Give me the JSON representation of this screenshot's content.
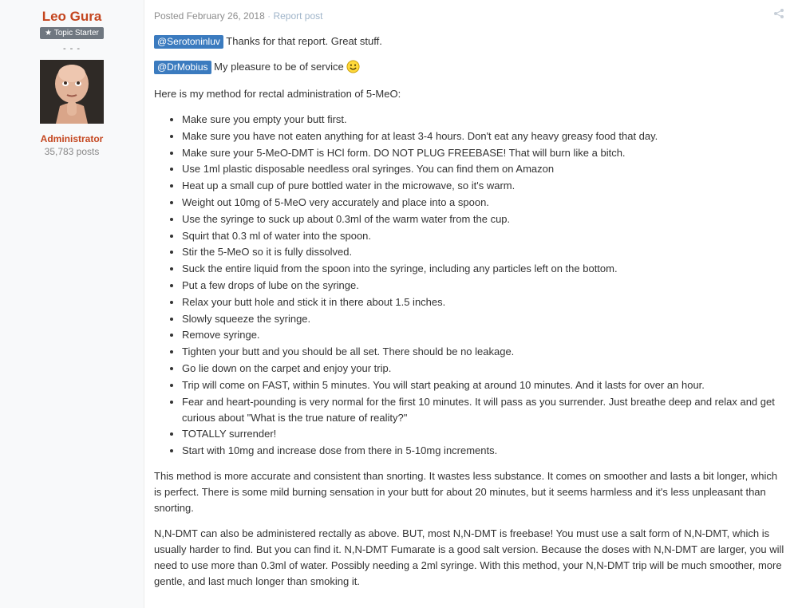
{
  "author": {
    "name": "Leo Gura",
    "badge": "Topic Starter",
    "dashes": "- - -",
    "role": "Administrator",
    "post_count": "35,783 posts"
  },
  "post": {
    "posted_label": "Posted February 26, 2018",
    "separator": "·",
    "report_label": "Report post",
    "mention1": "@Serotoninluv",
    "reply1": "Thanks for that report. Great stuff.",
    "mention2": "@DrMobius",
    "reply2": "My pleasure to be of service",
    "intro": "Here is my method for rectal administration of 5-MeO:",
    "steps": [
      "Make sure you empty your butt first.",
      "Make sure you have not eaten anything for at least 3-4 hours. Don't eat any heavy greasy food that day.",
      "Make sure your 5-MeO-DMT is HCl form. DO NOT PLUG FREEBASE! That will burn like a bitch.",
      "Use 1ml plastic disposable needless oral syringes. You can find them on Amazon",
      "Heat up a small cup of pure bottled water in the microwave, so it's warm.",
      "Weight out 10mg of 5-MeO very accurately and place into a spoon.",
      "Use the syringe to suck up about 0.3ml of the warm water from the cup.",
      "Squirt that 0.3 ml of water into the spoon.",
      "Stir the 5-MeO so it is fully dissolved.",
      "Suck the entire liquid from the spoon into the syringe, including any particles left on the bottom.",
      "Put a few drops of lube on the syringe.",
      "Relax your butt hole and stick it in there about 1.5 inches.",
      "Slowly squeeze the syringe.",
      "Remove syringe.",
      "Tighten your butt and you should be all set. There should be no leakage.",
      "Go lie down on the carpet and enjoy your trip.",
      "Trip will come on FAST, within 5 minutes. You will start peaking at around 10 minutes. And it lasts for over an hour.",
      "Fear and heart-pounding is very normal for the first 10 minutes. It will pass as you surrender. Just breathe deep and relax and get curious about \"What is the true nature of reality?\"",
      "TOTALLY surrender!",
      "Start with 10mg and increase dose from there in 5-10mg increments."
    ],
    "para1": "This method is more accurate and consistent than snorting. It wastes less substance. It comes on smoother and lasts a bit longer, which is perfect. There is some mild burning sensation in your butt for about 20 minutes, but it seems harmless and it's less unpleasant than snorting.",
    "para2": "N,N-DMT can also be administered rectally as above. BUT, most N,N-DMT is freebase! You must use a salt form of N,N-DMT, which is usually harder to find. But you can find it. N,N-DMT Fumarate is a good salt version. Because the doses with N,N-DMT are larger, you will need to use more than 0.3ml of water. Possibly needing a 2ml syringe. With this method, your N,N-DMT trip will be much smoother, more gentle, and last much longer than smoking it."
  },
  "icons": [
    "star-icon",
    "share-icon",
    "smiley-icon"
  ],
  "colors": {
    "author": "#c4461f",
    "mention_bg": "#3b7bbf",
    "badge_bg": "#6f7780",
    "sidebar_bg": "#f8f9fa"
  }
}
